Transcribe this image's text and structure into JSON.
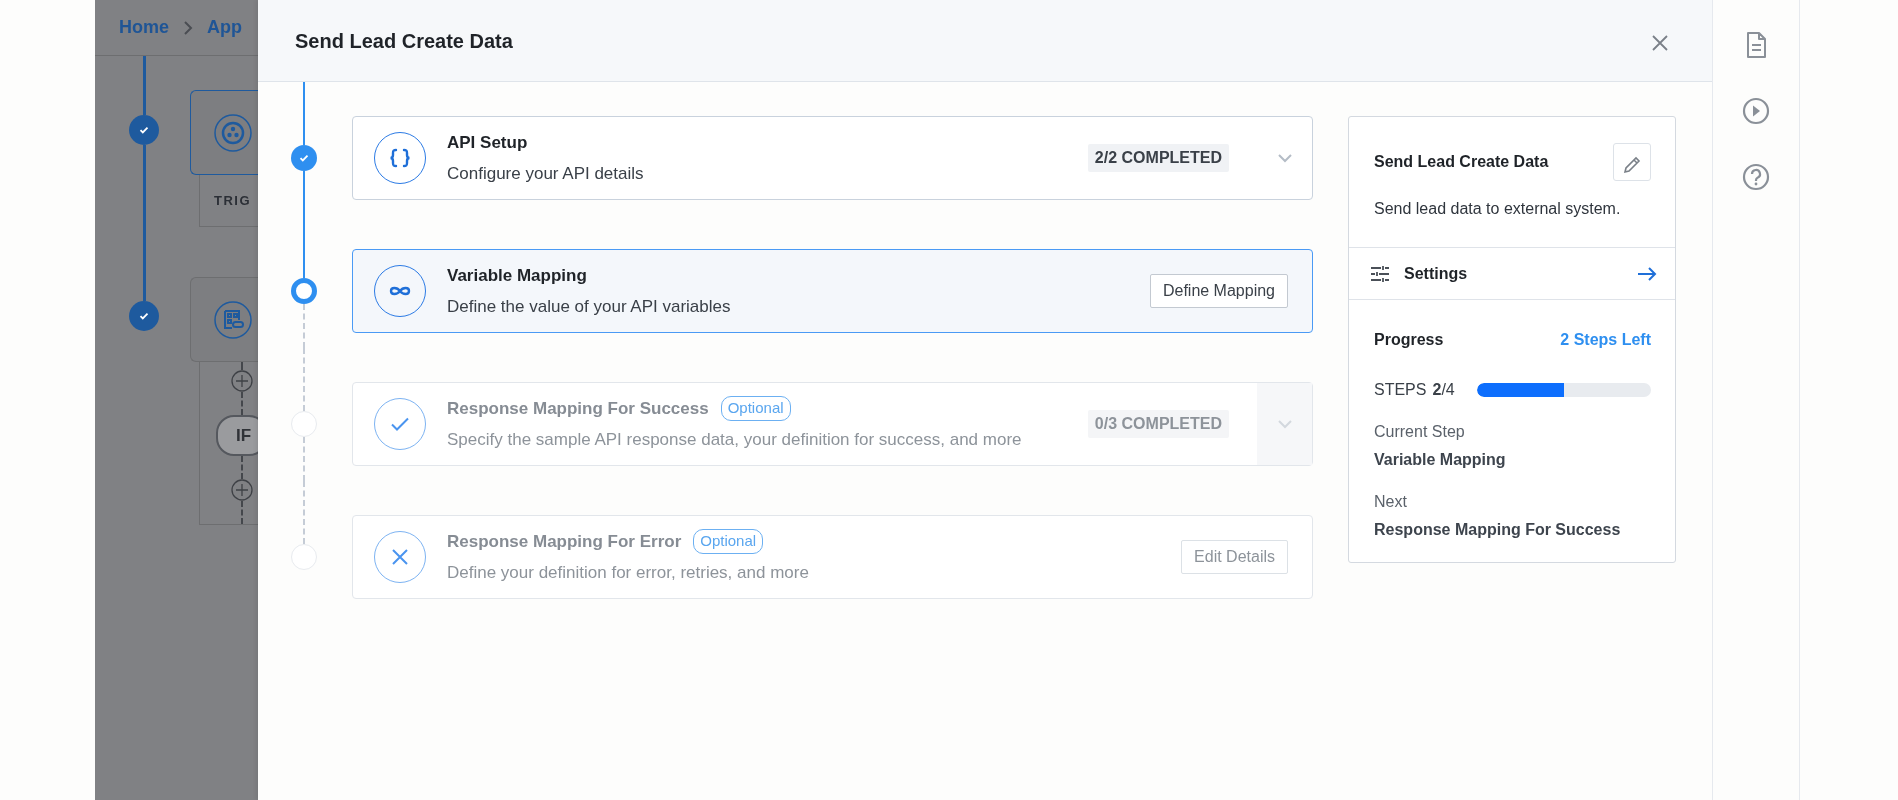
{
  "background": {
    "breadcrumb": [
      {
        "label": "Home"
      },
      {
        "label": "App"
      }
    ],
    "flow_nodes": [
      {
        "kind": "trigger",
        "checked": true,
        "caption": "TRIG"
      },
      {
        "kind": "action",
        "checked": true,
        "branch_label": "IF"
      }
    ]
  },
  "modal": {
    "title": "Send Lead Create Data",
    "steps": [
      {
        "kind": "progress",
        "completed": true,
        "active": false,
        "title": "API Setup",
        "description": "Configure your API details",
        "progress_text": "2/2 COMPLETED"
      },
      {
        "kind": "button",
        "completed": false,
        "active": true,
        "title": "Variable Mapping",
        "description": "Define the value of your API variables",
        "button": "Define Mapping"
      },
      {
        "kind": "progress",
        "completed": false,
        "active": false,
        "title": "Response Mapping For Success",
        "badge": "Optional",
        "description": "Specify the sample API response data, your definition for success, and more",
        "progress_text": "0/3 COMPLETED"
      },
      {
        "kind": "button",
        "completed": false,
        "active": false,
        "title": "Response Mapping For Error",
        "badge": "Optional",
        "description": "Define your definition for error, retries, and more",
        "button": "Edit Details"
      }
    ],
    "summary": {
      "title": "Send Lead Create Data",
      "description": "Send lead data to external system.",
      "settings_label": "Settings",
      "progress": {
        "heading": "Progress",
        "steps_left": "2 Steps Left",
        "steps_label": "STEPS",
        "steps_value": "**2**/4",
        "level": 0.5,
        "current_label": "Current Step",
        "current_value": "Variable Mapping",
        "next_label": "Next",
        "next_value": "Response Mapping For Success"
      }
    }
  }
}
